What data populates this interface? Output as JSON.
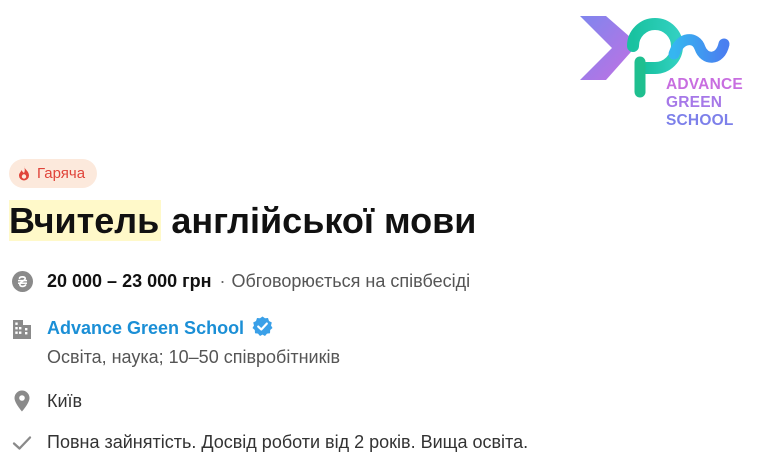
{
  "logo": {
    "line1": "ADVANCE",
    "line2": "GREEN",
    "line3": "SCHOOL"
  },
  "badge": {
    "label": "Гаряча",
    "icon": "flame-icon",
    "color": "#e0443a"
  },
  "title": {
    "highlighted": "Вчитель",
    "rest": " англійської мови"
  },
  "salary": {
    "range": "20 000 – 23 000 грн",
    "separator": "·",
    "note": "Обговорюється на співбесіді",
    "icon": "hryvnia-icon"
  },
  "company": {
    "name": "Advance Green School",
    "verified_icon": "verified-check-icon",
    "details": "Освіта, наука; 10–50 співробітників",
    "icon": "building-icon",
    "link_color": "#1b8fd6"
  },
  "location": {
    "city": "Київ",
    "icon": "map-pin-icon"
  },
  "requirements": {
    "text": "Повна зайнятість. Досвід роботи від 2 років. Вища освіта.",
    "icon": "checkmark-icon"
  }
}
